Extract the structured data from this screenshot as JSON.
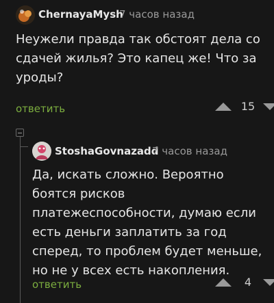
{
  "comments": [
    {
      "author": "ChernayaMysh",
      "time": "7 часов назад",
      "text": "Неужели правда так обстоят дела со сдачей жилья? Это капец же! Что за уроды?",
      "reply_label": "ответить",
      "rating": "15"
    },
    {
      "author": "StoshaGovnazadd",
      "time": "7 часов назад",
      "text": "Да, искать сложно. Вероятно боятся рисков платежеспособности, думаю если есть деньги заплатить за год сперед, то проблем будет меньше, но не у всех есть накопления.",
      "reply_label": "ответить",
      "rating": "4"
    }
  ],
  "icons": {
    "upvote": "triangle-up-icon",
    "downvote": "triangle-down-icon",
    "collapse": "minus-box-icon"
  },
  "colors": {
    "background": "#171717",
    "reply_link": "#7cae3f",
    "meta_text": "#9a9a9a"
  }
}
